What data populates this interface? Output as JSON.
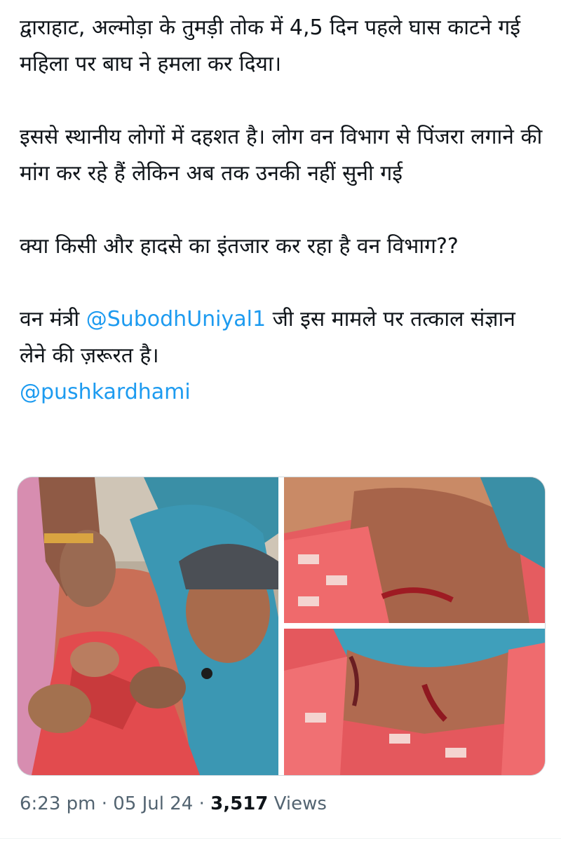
{
  "tweet": {
    "para1": "द्वाराहाट, अल्मोड़ा के तुमड़ी तोक में 4,5 दिन पहले घास काटने गई महिला पर बाघ ने हमला कर दिया।",
    "para2": "इससे स्थानीय लोगों में दहशत है। लोग वन विभाग से पिंजरा लगाने की मांग कर रहे हैं लेकिन अब तक उनकी नहीं सुनी गई",
    "para3": "क्या किसी और हादसे का इंतजार कर रहा है वन विभाग??",
    "para4_before": "वन मंत्री ",
    "mention1": "@SubodhUniyal1",
    "para4_after": " जी इस मामले पर तत्काल संज्ञान लेने की ज़रूरत है।",
    "mention2": "@pushkardhami"
  },
  "media": {
    "count": 3,
    "photos": [
      {
        "subject": "woman in blue scarf showing wounded shoulder"
      },
      {
        "subject": "close-up of shoulder wound"
      },
      {
        "subject": "close-up of neck wound"
      }
    ]
  },
  "meta": {
    "time": "6:23 pm",
    "separator": " · ",
    "date": "05 Jul 24",
    "views_count": "3,517",
    "views_label": " Views"
  },
  "colors": {
    "text": "#0f1419",
    "link": "#1d9bf0",
    "meta": "#536471"
  }
}
